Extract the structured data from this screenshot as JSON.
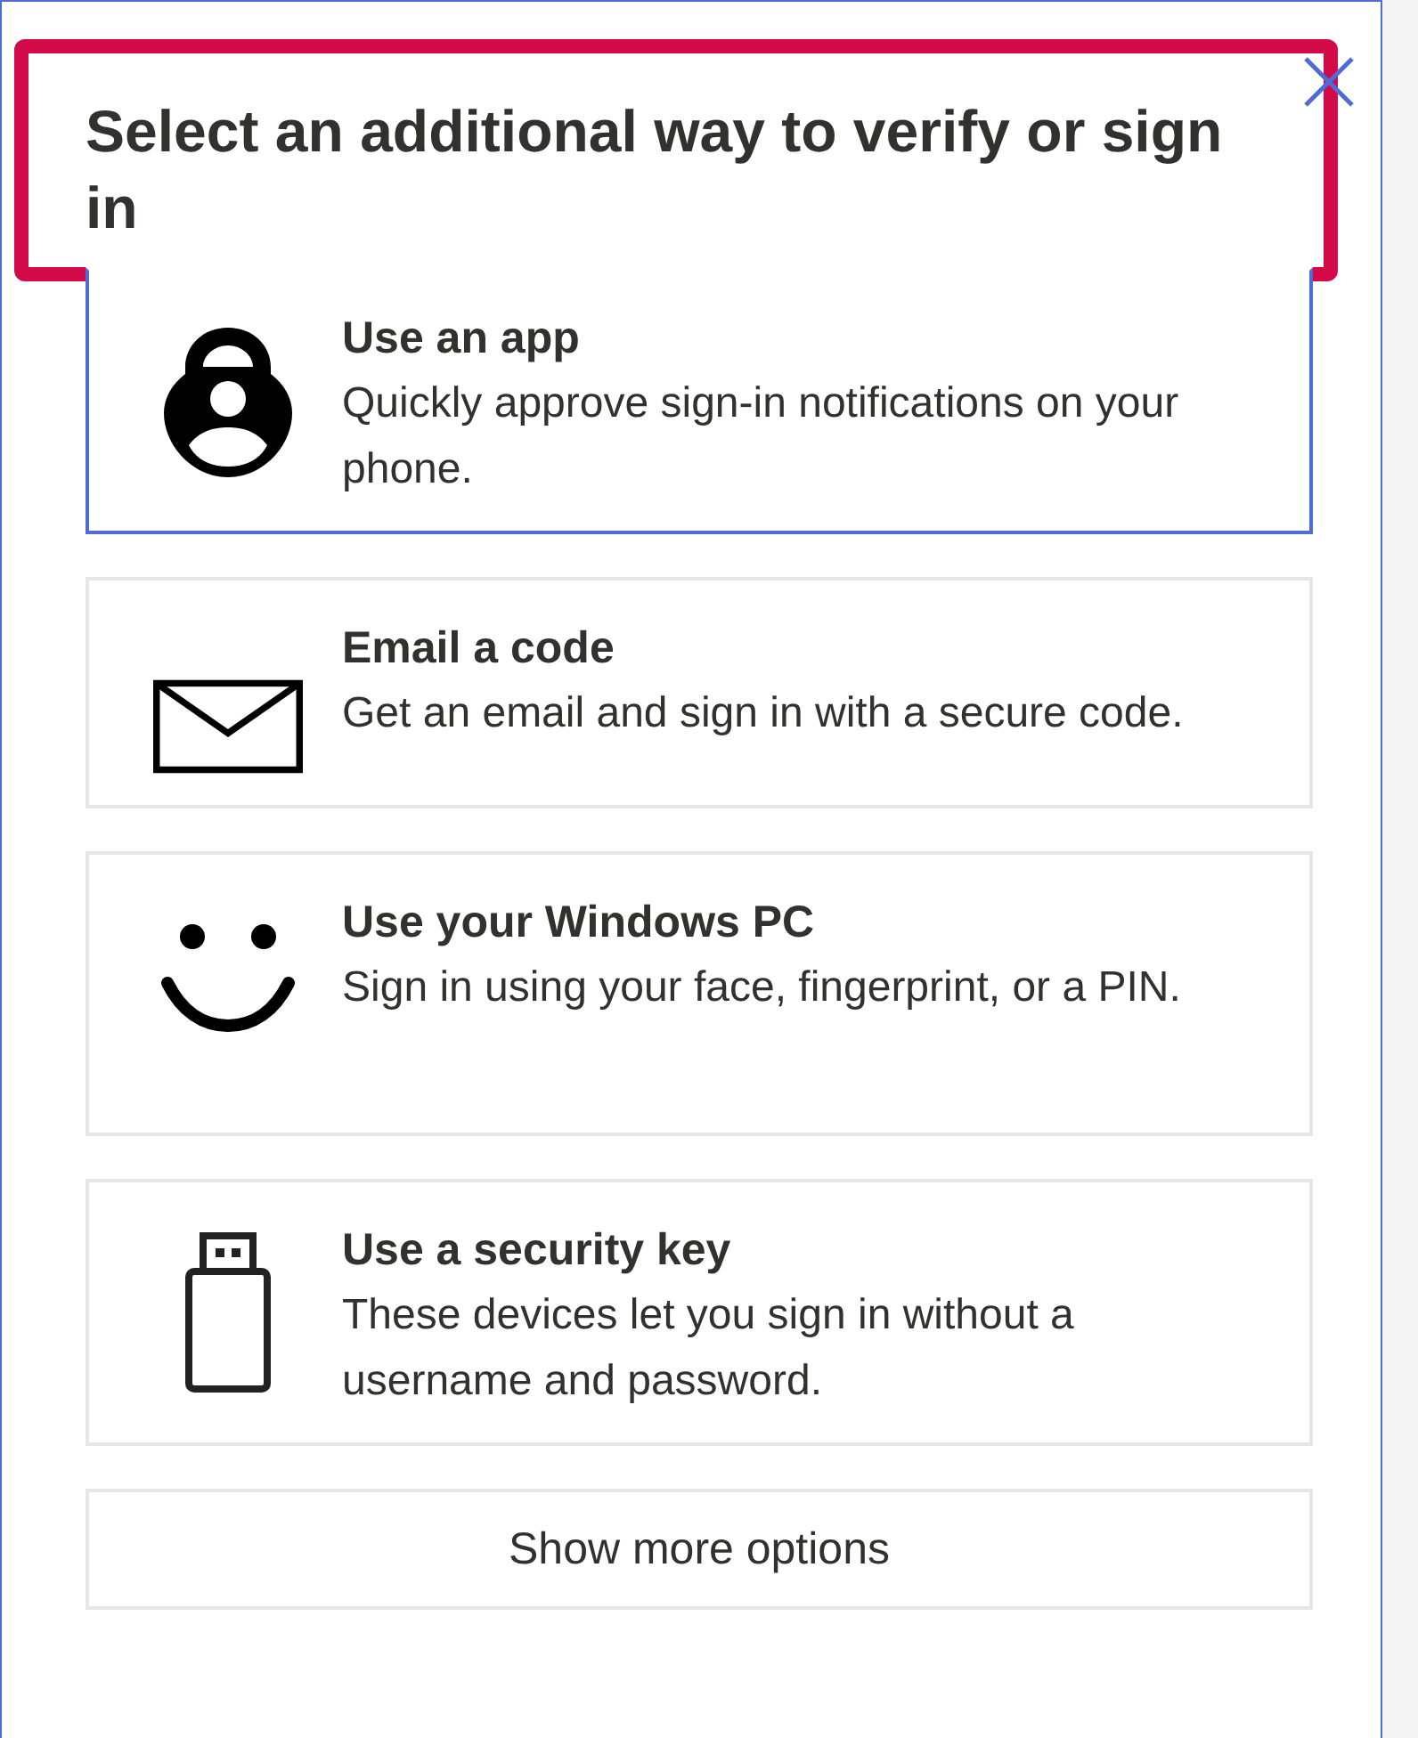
{
  "dialog": {
    "title": "Select an additional way to verify or sign in",
    "title_highlighted": true,
    "options": [
      {
        "kind": "app",
        "title": "Use an app",
        "description": "Quickly approve sign-in notifications on your phone.",
        "selected": true
      },
      {
        "kind": "email",
        "title": "Email a code",
        "description": "Get an email and sign in with a secure code.",
        "selected": false
      },
      {
        "kind": "face",
        "title": "Use your Windows PC",
        "description": "Sign in using your face, fingerprint, or a PIN.",
        "selected": false
      },
      {
        "kind": "key",
        "title": "Use a security key",
        "description": "These devices let you sign in without a username and password.",
        "selected": false
      }
    ],
    "more_button": "Show more options"
  }
}
